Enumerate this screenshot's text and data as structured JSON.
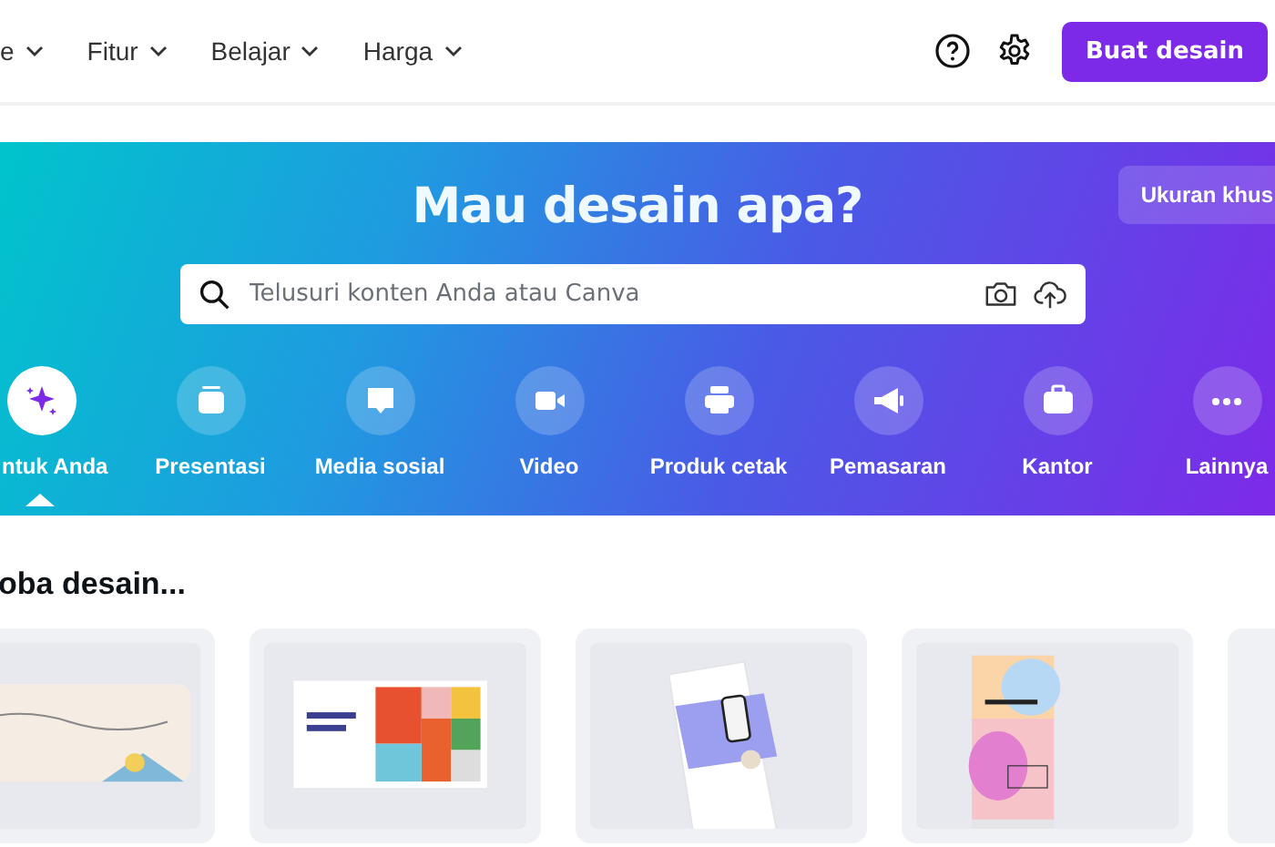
{
  "nav": {
    "items": [
      {
        "label": "e"
      },
      {
        "label": "Fitur"
      },
      {
        "label": "Belajar"
      },
      {
        "label": "Harga"
      }
    ],
    "create_button": "Buat desain"
  },
  "hero": {
    "title": "Mau desain apa?",
    "custom_size_button": "Ukuran khus",
    "search": {
      "placeholder": "Telusuri konten Anda atau Canva"
    },
    "categories": [
      {
        "label": "ntuk Anda",
        "selected": true
      },
      {
        "label": "Presentasi",
        "selected": false
      },
      {
        "label": "Media sosial",
        "selected": false
      },
      {
        "label": "Video",
        "selected": false
      },
      {
        "label": "Produk cetak",
        "selected": false
      },
      {
        "label": "Pemasaran",
        "selected": false
      },
      {
        "label": "Kantor",
        "selected": false
      },
      {
        "label": "Lainnya",
        "selected": false
      }
    ]
  },
  "section": {
    "heading": "oba desain...",
    "cards": [
      {
        "kind": "picture"
      },
      {
        "kind": "picture"
      },
      {
        "kind": "picture"
      },
      {
        "kind": "picture"
      },
      {
        "kind": "blank"
      }
    ]
  }
}
